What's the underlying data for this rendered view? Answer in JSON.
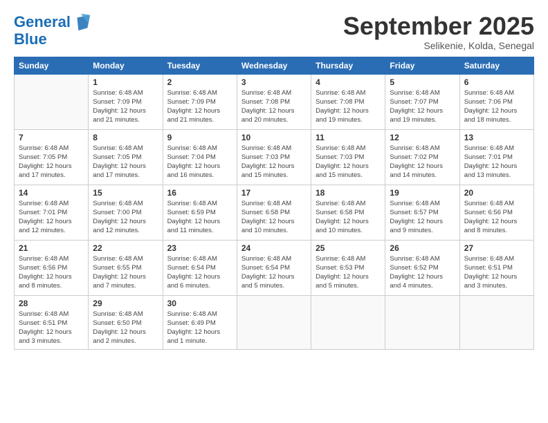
{
  "header": {
    "logo_line1": "General",
    "logo_line2": "Blue",
    "month": "September 2025",
    "location": "Selikenie, Kolda, Senegal"
  },
  "days_of_week": [
    "Sunday",
    "Monday",
    "Tuesday",
    "Wednesday",
    "Thursday",
    "Friday",
    "Saturday"
  ],
  "weeks": [
    [
      {
        "num": "",
        "info": ""
      },
      {
        "num": "1",
        "info": "Sunrise: 6:48 AM\nSunset: 7:09 PM\nDaylight: 12 hours\nand 21 minutes."
      },
      {
        "num": "2",
        "info": "Sunrise: 6:48 AM\nSunset: 7:09 PM\nDaylight: 12 hours\nand 21 minutes."
      },
      {
        "num": "3",
        "info": "Sunrise: 6:48 AM\nSunset: 7:08 PM\nDaylight: 12 hours\nand 20 minutes."
      },
      {
        "num": "4",
        "info": "Sunrise: 6:48 AM\nSunset: 7:08 PM\nDaylight: 12 hours\nand 19 minutes."
      },
      {
        "num": "5",
        "info": "Sunrise: 6:48 AM\nSunset: 7:07 PM\nDaylight: 12 hours\nand 19 minutes."
      },
      {
        "num": "6",
        "info": "Sunrise: 6:48 AM\nSunset: 7:06 PM\nDaylight: 12 hours\nand 18 minutes."
      }
    ],
    [
      {
        "num": "7",
        "info": "Sunrise: 6:48 AM\nSunset: 7:05 PM\nDaylight: 12 hours\nand 17 minutes."
      },
      {
        "num": "8",
        "info": "Sunrise: 6:48 AM\nSunset: 7:05 PM\nDaylight: 12 hours\nand 17 minutes."
      },
      {
        "num": "9",
        "info": "Sunrise: 6:48 AM\nSunset: 7:04 PM\nDaylight: 12 hours\nand 16 minutes."
      },
      {
        "num": "10",
        "info": "Sunrise: 6:48 AM\nSunset: 7:03 PM\nDaylight: 12 hours\nand 15 minutes."
      },
      {
        "num": "11",
        "info": "Sunrise: 6:48 AM\nSunset: 7:03 PM\nDaylight: 12 hours\nand 15 minutes."
      },
      {
        "num": "12",
        "info": "Sunrise: 6:48 AM\nSunset: 7:02 PM\nDaylight: 12 hours\nand 14 minutes."
      },
      {
        "num": "13",
        "info": "Sunrise: 6:48 AM\nSunset: 7:01 PM\nDaylight: 12 hours\nand 13 minutes."
      }
    ],
    [
      {
        "num": "14",
        "info": "Sunrise: 6:48 AM\nSunset: 7:01 PM\nDaylight: 12 hours\nand 12 minutes."
      },
      {
        "num": "15",
        "info": "Sunrise: 6:48 AM\nSunset: 7:00 PM\nDaylight: 12 hours\nand 12 minutes."
      },
      {
        "num": "16",
        "info": "Sunrise: 6:48 AM\nSunset: 6:59 PM\nDaylight: 12 hours\nand 11 minutes."
      },
      {
        "num": "17",
        "info": "Sunrise: 6:48 AM\nSunset: 6:58 PM\nDaylight: 12 hours\nand 10 minutes."
      },
      {
        "num": "18",
        "info": "Sunrise: 6:48 AM\nSunset: 6:58 PM\nDaylight: 12 hours\nand 10 minutes."
      },
      {
        "num": "19",
        "info": "Sunrise: 6:48 AM\nSunset: 6:57 PM\nDaylight: 12 hours\nand 9 minutes."
      },
      {
        "num": "20",
        "info": "Sunrise: 6:48 AM\nSunset: 6:56 PM\nDaylight: 12 hours\nand 8 minutes."
      }
    ],
    [
      {
        "num": "21",
        "info": "Sunrise: 6:48 AM\nSunset: 6:56 PM\nDaylight: 12 hours\nand 8 minutes."
      },
      {
        "num": "22",
        "info": "Sunrise: 6:48 AM\nSunset: 6:55 PM\nDaylight: 12 hours\nand 7 minutes."
      },
      {
        "num": "23",
        "info": "Sunrise: 6:48 AM\nSunset: 6:54 PM\nDaylight: 12 hours\nand 6 minutes."
      },
      {
        "num": "24",
        "info": "Sunrise: 6:48 AM\nSunset: 6:54 PM\nDaylight: 12 hours\nand 5 minutes."
      },
      {
        "num": "25",
        "info": "Sunrise: 6:48 AM\nSunset: 6:53 PM\nDaylight: 12 hours\nand 5 minutes."
      },
      {
        "num": "26",
        "info": "Sunrise: 6:48 AM\nSunset: 6:52 PM\nDaylight: 12 hours\nand 4 minutes."
      },
      {
        "num": "27",
        "info": "Sunrise: 6:48 AM\nSunset: 6:51 PM\nDaylight: 12 hours\nand 3 minutes."
      }
    ],
    [
      {
        "num": "28",
        "info": "Sunrise: 6:48 AM\nSunset: 6:51 PM\nDaylight: 12 hours\nand 3 minutes."
      },
      {
        "num": "29",
        "info": "Sunrise: 6:48 AM\nSunset: 6:50 PM\nDaylight: 12 hours\nand 2 minutes."
      },
      {
        "num": "30",
        "info": "Sunrise: 6:48 AM\nSunset: 6:49 PM\nDaylight: 12 hours\nand 1 minute."
      },
      {
        "num": "",
        "info": ""
      },
      {
        "num": "",
        "info": ""
      },
      {
        "num": "",
        "info": ""
      },
      {
        "num": "",
        "info": ""
      }
    ]
  ]
}
